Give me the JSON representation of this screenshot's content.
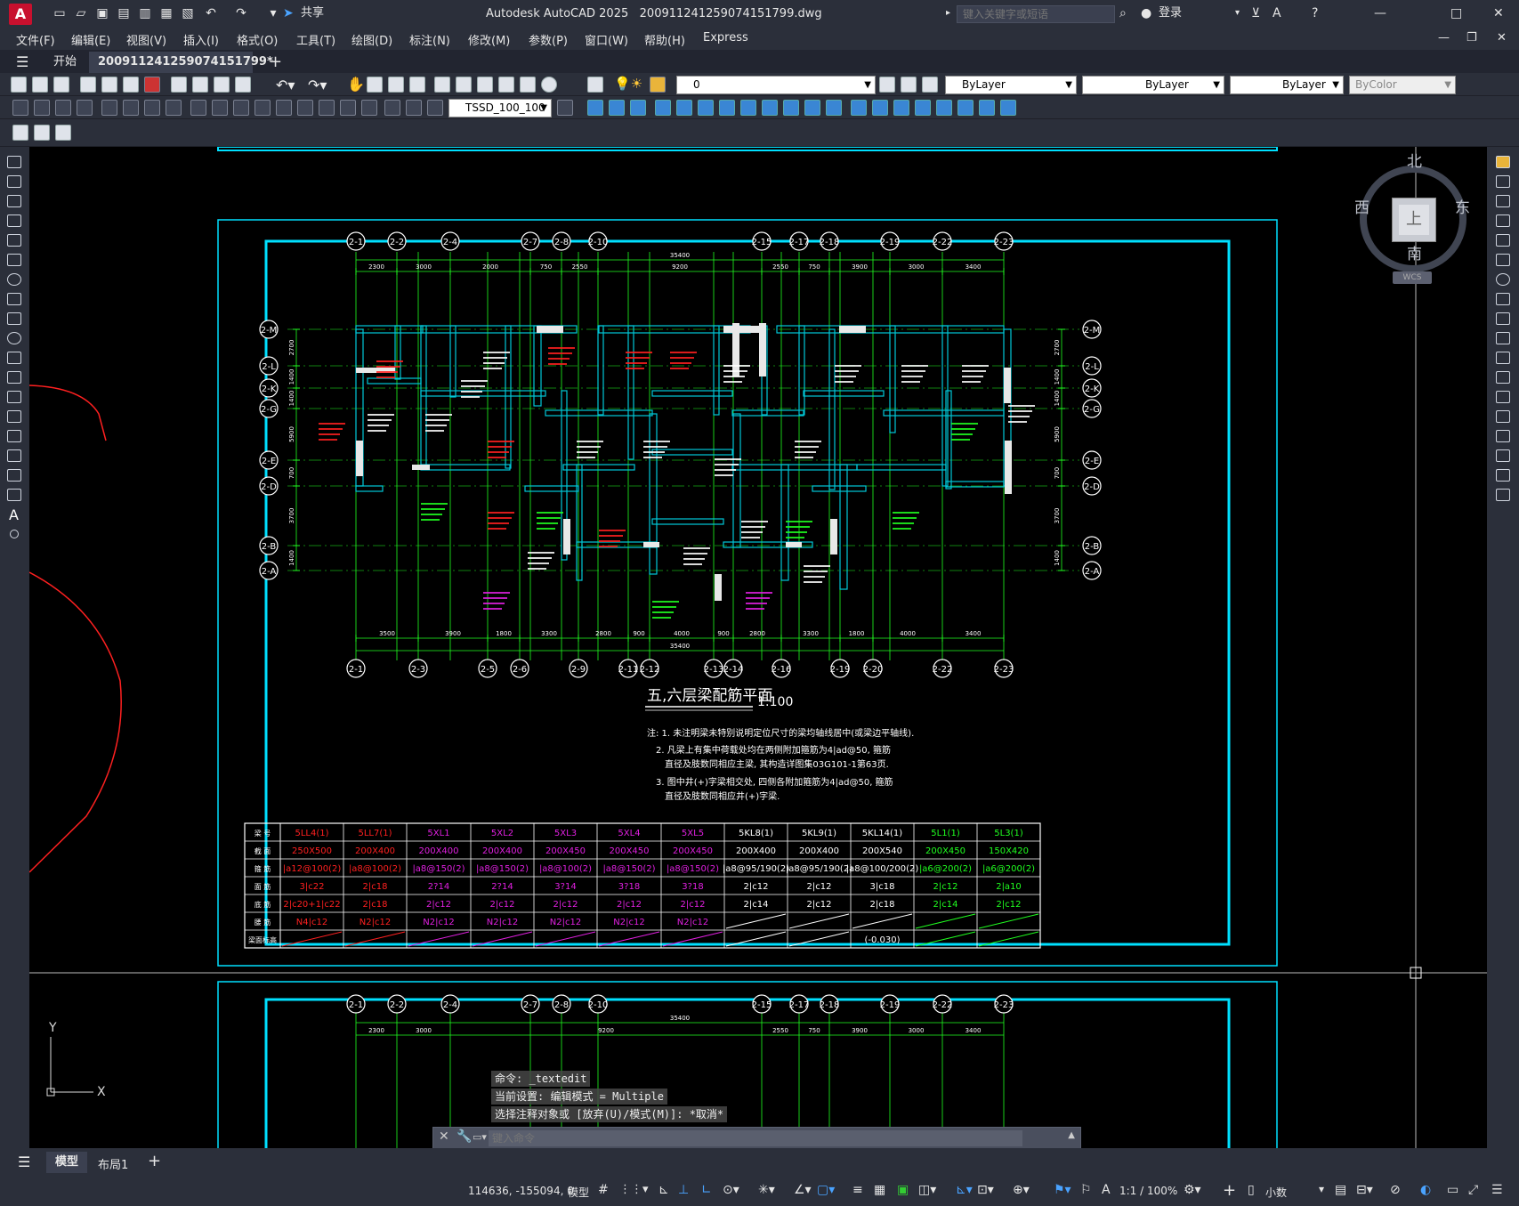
{
  "titlebar": {
    "app_title": "Autodesk AutoCAD 2025",
    "file_name": "2009112412590741517​99.dwg",
    "share_label": "共享",
    "search_placeholder": "键入关键字或短语",
    "login_label": "登录"
  },
  "menu": [
    "文件(F)",
    "编辑(E)",
    "视图(V)",
    "插入(I)",
    "格式(O)",
    "工具(T)",
    "绘图(D)",
    "标注(N)",
    "修改(M)",
    "参数(P)",
    "窗口(W)",
    "帮助(H)",
    "Express"
  ],
  "tabs": {
    "start_label": "开始",
    "doc_label": "200911241259074151799*"
  },
  "properties": {
    "layer_value": "0",
    "color_value": "ByLayer",
    "linetype_value": "ByLayer",
    "lineweight_value": "ByLayer",
    "plotstyle_value": "ByColor",
    "textstyle_value": "TSSD_100_100"
  },
  "drawing": {
    "title": "五,六层梁配筋平面",
    "scale": "1:100",
    "notes": [
      "注: 1. 未注明梁未特别说明定位尺寸的梁均轴线居中(或梁边平轴线).",
      "2. 凡梁上有集中荷载处均在两侧附加箍筋为4|ad@50, 箍筋",
      "直径及肢数同相应主梁, 其构造详图集03G101-1第63页.",
      "3. 图中井(+)字梁相交处, 四侧各附加箍筋为4|ad@50, 箍筋",
      "直径及肢数同相应井(+)字梁."
    ],
    "top_axes": [
      "2-1",
      "2-2",
      "2-4",
      "2-7",
      "2-8",
      "2-10",
      "2-15",
      "2-17",
      "2-18",
      "2-19",
      "2-22",
      "2-23"
    ],
    "bottom_axes": [
      "2-1",
      "2-3",
      "2-5",
      "2-6",
      "2-9",
      "2-11",
      "2-12",
      "2-13",
      "2-14",
      "2-16",
      "2-19",
      "2-20",
      "2-22",
      "2-23"
    ],
    "left_axes": [
      "2-M",
      "2-L",
      "2-K",
      "2-G",
      "2-E",
      "2-D",
      "2-B",
      "2-A"
    ],
    "top_dims": [
      "2300",
      "3000",
      "2000",
      "750",
      "2550",
      "9200",
      "2550",
      "750",
      "3900",
      "3000",
      "3400"
    ],
    "top_total": "35400",
    "bottom_dims": [
      "3500",
      "3900",
      "1800",
      "3300",
      "2800",
      "900",
      "4000",
      "900",
      "2800",
      "3300",
      "1800",
      "4000",
      "3400"
    ],
    "bottom_total": "35400",
    "left_dims": [
      "2700",
      "1400",
      "1400",
      "5900",
      "700",
      "3700",
      "1400"
    ]
  },
  "beam_table": {
    "row_headers": [
      "梁 号",
      "截 面",
      "箍 筋",
      "面 筋",
      "底 筋",
      "腰 筋",
      "梁面标高"
    ],
    "columns": [
      {
        "id": "5LL4(1)",
        "sec": "250X500",
        "stir": "|a12@100(2)",
        "top": "3|c22",
        "bot": "2|c20+1|c22",
        "waist": "N4|c12",
        "lvl": "",
        "color": "#ff2020"
      },
      {
        "id": "5LL7(1)",
        "sec": "200X400",
        "stir": "|a8@100(2)",
        "top": "2|c18",
        "bot": "2|c18",
        "waist": "N2|c12",
        "lvl": "",
        "color": "#ff2020"
      },
      {
        "id": "5XL1",
        "sec": "200X400",
        "stir": "|a8@150(2)",
        "top": "2?14",
        "bot": "2|c12",
        "waist": "N2|c12",
        "lvl": "",
        "color": "#e020e0"
      },
      {
        "id": "5XL2",
        "sec": "200X400",
        "stir": "|a8@150(2)",
        "top": "2?14",
        "bot": "2|c12",
        "waist": "N2|c12",
        "lvl": "",
        "color": "#e020e0"
      },
      {
        "id": "5XL3",
        "sec": "200X450",
        "stir": "|a8@100(2)",
        "top": "3?14",
        "bot": "2|c12",
        "waist": "N2|c12",
        "lvl": "",
        "color": "#e020e0"
      },
      {
        "id": "5XL4",
        "sec": "200X450",
        "stir": "|a8@150(2)",
        "top": "3?18",
        "bot": "2|c12",
        "waist": "N2|c12",
        "lvl": "",
        "color": "#e020e0"
      },
      {
        "id": "5XL5",
        "sec": "200X450",
        "stir": "|a8@150(2)",
        "top": "3?18",
        "bot": "2|c12",
        "waist": "N2|c12",
        "lvl": "",
        "color": "#e020e0"
      },
      {
        "id": "5KL8(1)",
        "sec": "200X400",
        "stir": "|a8@95/190(2)",
        "top": "2|c12",
        "bot": "2|c14",
        "waist": "",
        "lvl": "",
        "color": "#ffffff"
      },
      {
        "id": "5KL9(1)",
        "sec": "200X400",
        "stir": "|a8@95/190(2)",
        "top": "2|c12",
        "bot": "2|c12",
        "waist": "",
        "lvl": "",
        "color": "#ffffff"
      },
      {
        "id": "5KL14(1)",
        "sec": "200X540",
        "stir": "|a8@100/200(2)",
        "top": "3|c18",
        "bot": "2|c18",
        "waist": "",
        "lvl": "(-0.030)",
        "color": "#ffffff"
      },
      {
        "id": "5L1(1)",
        "sec": "200X450",
        "stir": "|a6@200(2)",
        "top": "2|c12",
        "bot": "2|c14",
        "waist": "",
        "lvl": "",
        "color": "#20ff20"
      },
      {
        "id": "5L3(1)",
        "sec": "150X420",
        "stir": "|a6@200(2)",
        "top": "2|a10",
        "bot": "2|c12",
        "waist": "",
        "lvl": "",
        "color": "#20ff20"
      }
    ]
  },
  "lower_sheet": {
    "axes": [
      "2-1",
      "2-2",
      "2-4",
      "2-7",
      "2-8",
      "2-10",
      "2-15",
      "2-17",
      "2-18",
      "2-19",
      "2-22",
      "2-23"
    ],
    "dims": [
      "2300",
      "3000",
      "9200",
      "2550",
      "750",
      "3900",
      "3000",
      "3400"
    ],
    "total": "35400"
  },
  "viewcube": {
    "north": "北",
    "south": "南",
    "east": "东",
    "west": "西",
    "face": "上",
    "wcs": "WCS"
  },
  "ucs": {
    "y": "Y",
    "x": "X"
  },
  "command": {
    "history": [
      "命令: _textedit",
      "当前设置: 编辑模式 = Multiple",
      "选择注释对象或 [放弃(U)/模式(M)]: *取消*"
    ],
    "placeholder": "键入命令"
  },
  "layouts": {
    "model": "模型",
    "layout1": "布局1"
  },
  "status": {
    "coords": "114636, -155094, 0",
    "model": "模型",
    "scale": "1:1 / 100%",
    "units": "小数"
  },
  "colors": {
    "accent_cyan": "#00e0ff",
    "red": "#ff2020",
    "green": "#20ff20",
    "magenta": "#e020e0",
    "beam_fill": "#e8e8e8"
  }
}
